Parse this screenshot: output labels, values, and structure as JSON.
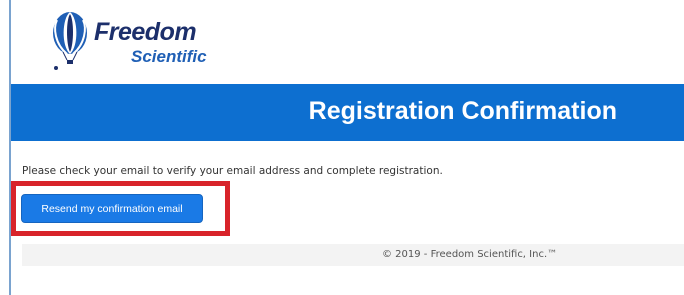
{
  "header": {
    "logo": {
      "line1": "Freedom",
      "line2": "Scientific",
      "icon": "hot-air-balloon-icon"
    }
  },
  "banner": {
    "title": "Registration Confirmation"
  },
  "main": {
    "message": "Please check your email to verify your email address and complete registration.",
    "resend_label": "Resend my confirmation email"
  },
  "footer": {
    "copyright": "© 2019 - Freedom Scientific, Inc.™"
  },
  "colors": {
    "banner_blue": "#0d6fd0",
    "button_blue": "#1a7ae6",
    "highlight_red": "#d8232a",
    "logo_navy": "#1c2f6b"
  }
}
